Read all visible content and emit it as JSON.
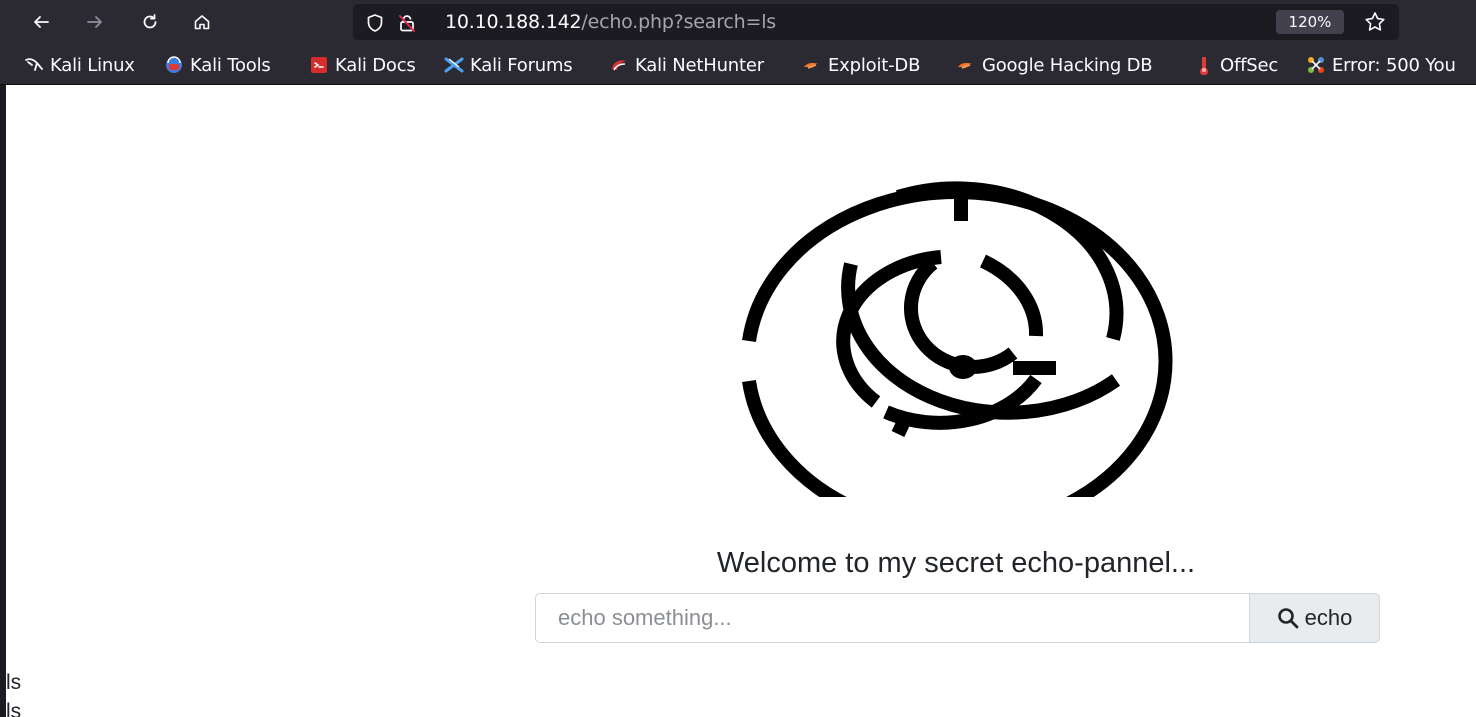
{
  "browser": {
    "url_host": "10.10.188.142",
    "url_path": "/echo.php?search=ls",
    "zoom": "120%",
    "bookmarks": [
      {
        "label": "Kali Linux",
        "icon": "kali-dragon-icon"
      },
      {
        "label": "Kali Tools",
        "icon": "kali-tools-icon"
      },
      {
        "label": "Kali Docs",
        "icon": "kali-docs-icon"
      },
      {
        "label": "Kali Forums",
        "icon": "kali-forums-icon"
      },
      {
        "label": "Kali NetHunter",
        "icon": "kali-nethunter-icon"
      },
      {
        "label": "Exploit-DB",
        "icon": "exploit-db-icon"
      },
      {
        "label": "Google Hacking DB",
        "icon": "ghdb-icon"
      },
      {
        "label": "OffSec",
        "icon": "offsec-icon"
      },
      {
        "label": "Error: 500 You",
        "icon": "joomla-icon"
      }
    ]
  },
  "page": {
    "logo": "maze-icon",
    "welcome": "Welcome to my secret echo-pannel...",
    "search": {
      "placeholder": "echo something...",
      "button_label": "echo"
    },
    "output_lines": [
      "ls",
      "ls"
    ]
  },
  "colors": {
    "chrome_bg": "#2b2a33",
    "urlbar_bg": "#1c1b22",
    "page_bg": "#ffffff",
    "maze": "#000000"
  }
}
